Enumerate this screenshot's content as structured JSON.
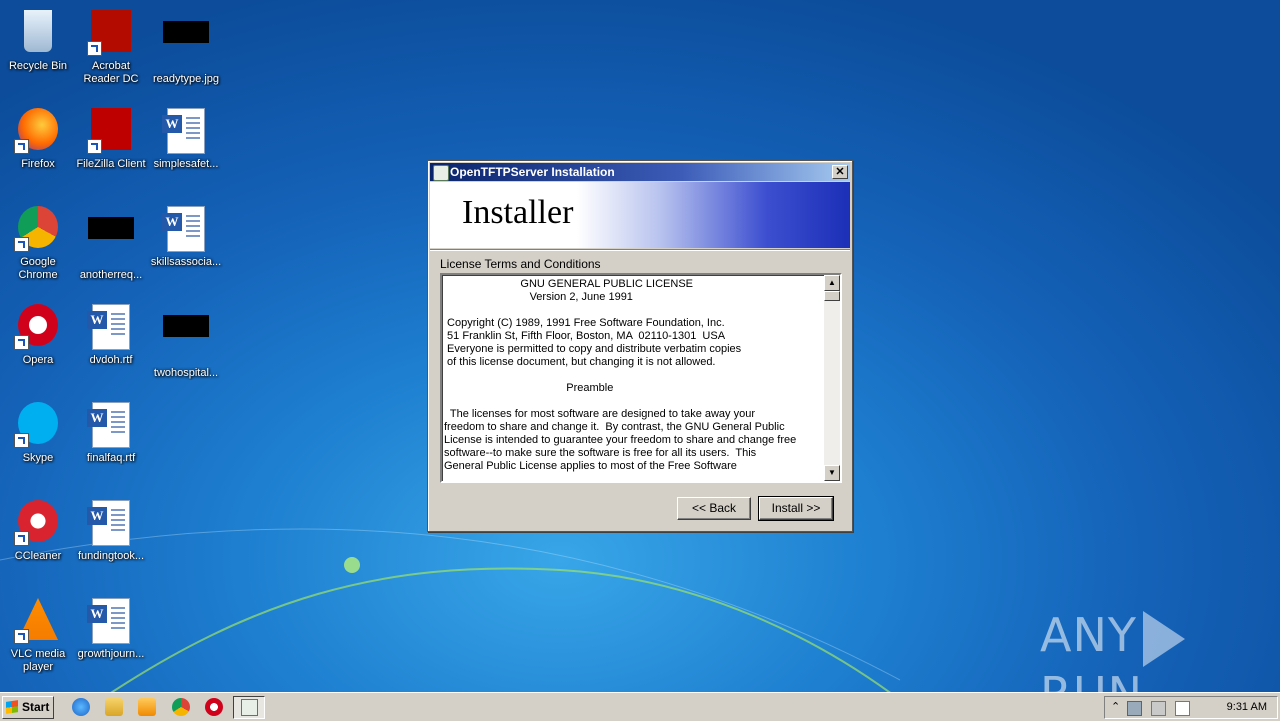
{
  "desktop": {
    "icons": [
      {
        "label": "Recycle Bin",
        "icon": "recycle-bin-icon"
      },
      {
        "label": "Acrobat Reader DC",
        "icon": "acrobat-icon"
      },
      {
        "label": "readytype.jpg",
        "icon": "image-thumbnail-icon"
      },
      {
        "label": "Firefox",
        "icon": "firefox-icon"
      },
      {
        "label": "FileZilla Client",
        "icon": "filezilla-icon"
      },
      {
        "label": "simplesafet...",
        "icon": "word-doc-icon"
      },
      {
        "label": "Google Chrome",
        "icon": "chrome-icon"
      },
      {
        "label": "anotherreq...",
        "icon": "image-thumbnail-icon"
      },
      {
        "label": "skillsassocia...",
        "icon": "word-doc-icon"
      },
      {
        "label": "Opera",
        "icon": "opera-icon"
      },
      {
        "label": "dvdoh.rtf",
        "icon": "word-doc-icon"
      },
      {
        "label": "twohospital...",
        "icon": "image-thumbnail-icon"
      },
      {
        "label": "Skype",
        "icon": "skype-icon"
      },
      {
        "label": "finalfaq.rtf",
        "icon": "word-doc-icon"
      },
      {
        "label": "CCleaner",
        "icon": "ccleaner-icon"
      },
      {
        "label": "fundingtook...",
        "icon": "word-doc-icon"
      },
      {
        "label": "VLC media player",
        "icon": "vlc-icon"
      },
      {
        "label": "growthjourn...",
        "icon": "word-doc-icon"
      }
    ]
  },
  "dialog": {
    "title": "OpenTFTPServer Installation",
    "banner_title": "Installer",
    "section_label": "License Terms and Conditions",
    "license_lines": [
      "                         GNU GENERAL PUBLIC LICENSE",
      "                            Version 2, June 1991",
      "",
      " Copyright (C) 1989, 1991 Free Software Foundation, Inc.",
      " 51 Franklin St, Fifth Floor, Boston, MA  02110-1301  USA",
      " Everyone is permitted to copy and distribute verbatim copies",
      " of this license document, but changing it is not allowed.",
      "",
      "                                        Preamble",
      "",
      "  The licenses for most software are designed to take away your",
      "freedom to share and change it.  By contrast, the GNU General Public",
      "License is intended to guarantee your freedom to share and change free",
      "software--to make sure the software is free for all its users.  This",
      "General Public License applies to most of the Free Software"
    ],
    "back_label": "<< Back",
    "install_label": "Install >>",
    "close_label": "✕"
  },
  "taskbar": {
    "start_label": "Start",
    "clock": "9:31 AM",
    "tray_expand": "⌃"
  },
  "watermark": {
    "left": "ANY",
    "right": "RUN"
  }
}
